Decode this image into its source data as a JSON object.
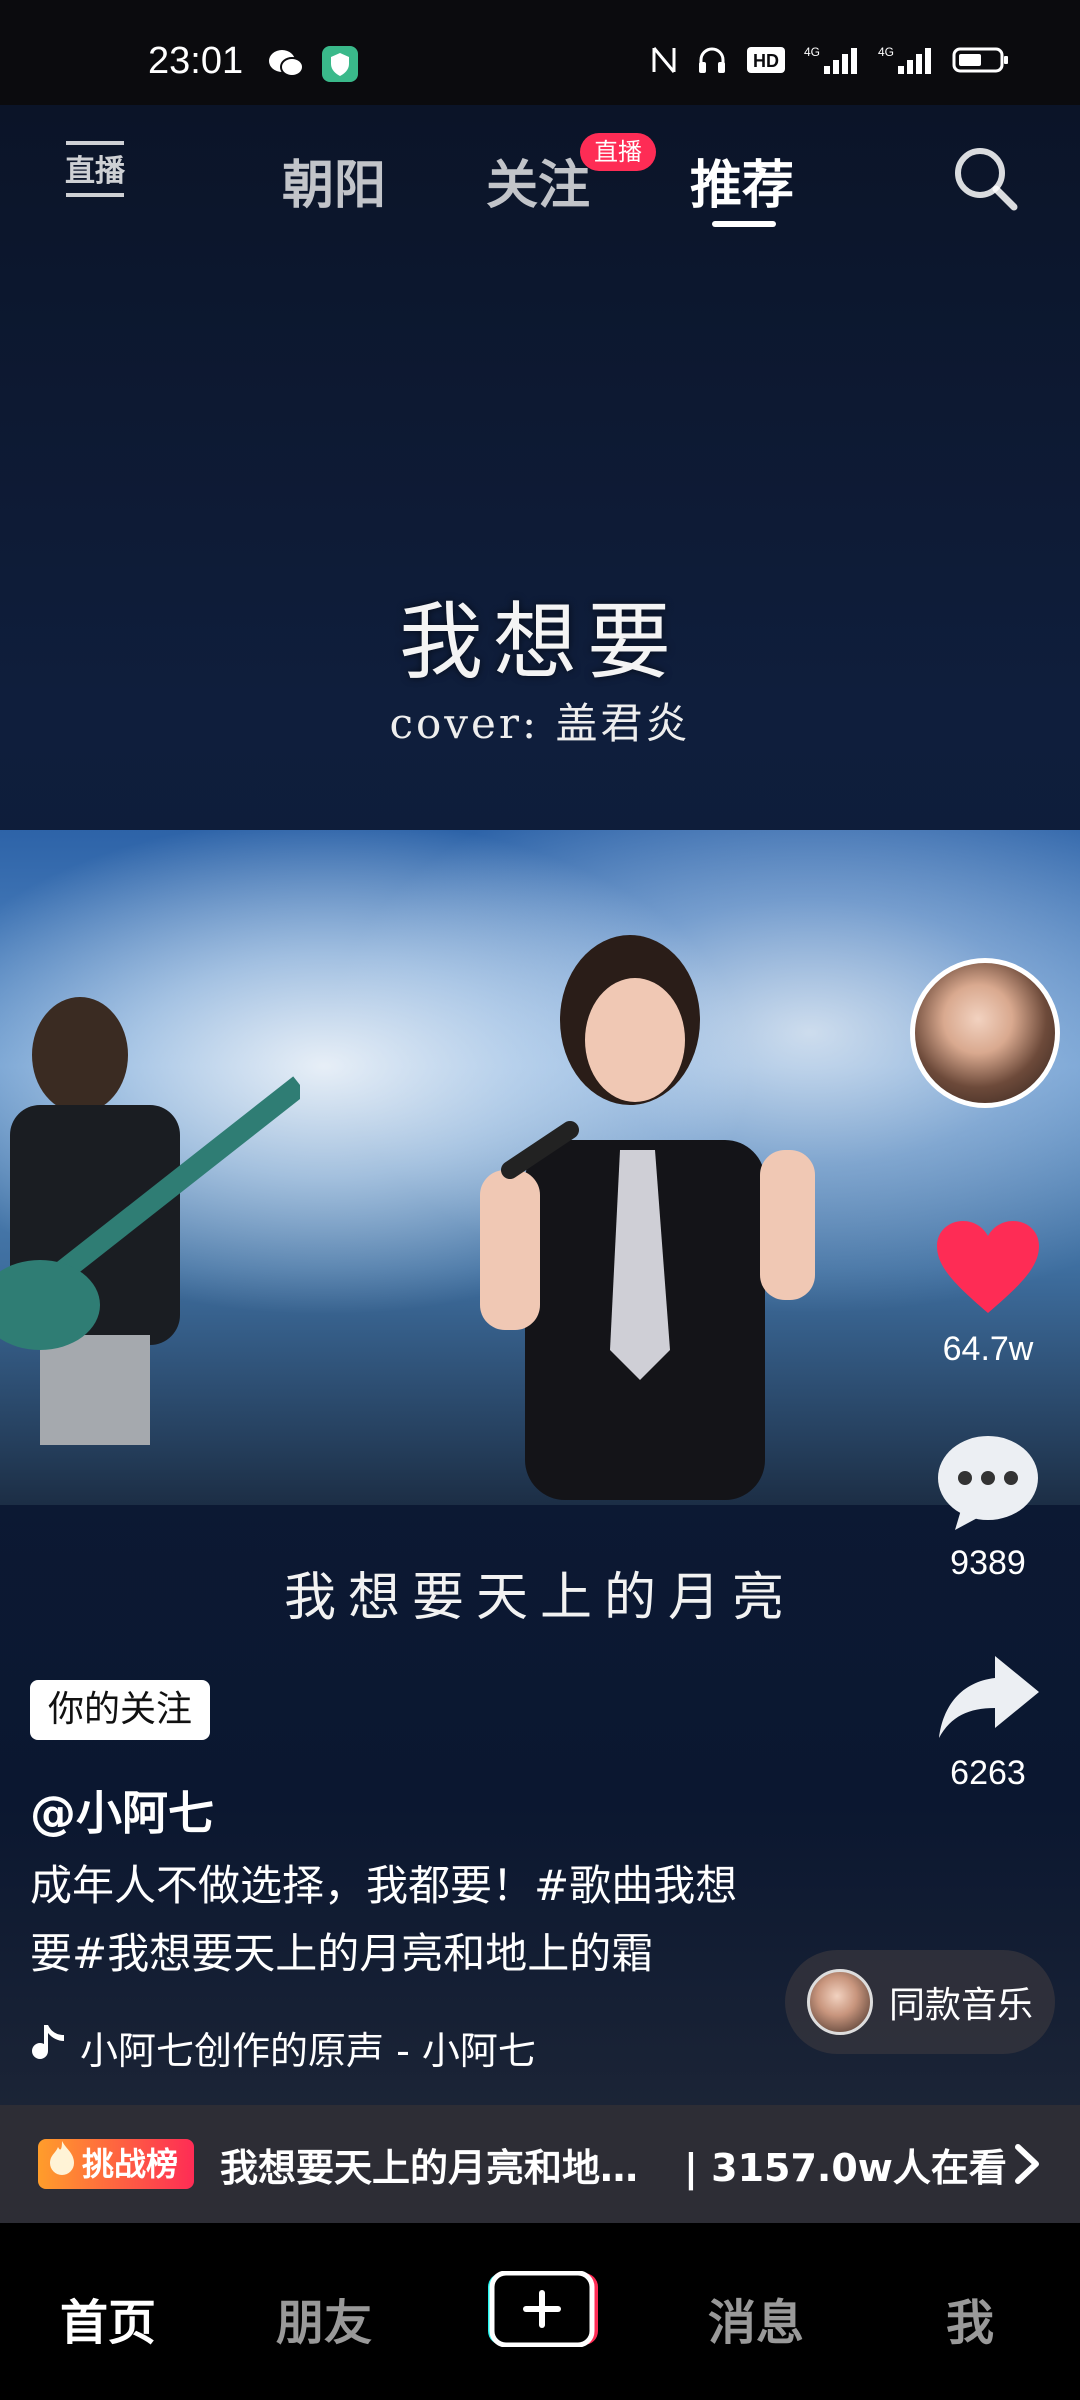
{
  "status_bar": {
    "time": "23:01",
    "hd_label": "HD",
    "net1": "4G",
    "net2": "4G"
  },
  "top_nav": {
    "live_label": "直播",
    "tabs": [
      {
        "label": "朝阳",
        "active": false
      },
      {
        "label": "关注",
        "active": false
      },
      {
        "label": "推荐",
        "active": true
      }
    ],
    "live_badge": "直播"
  },
  "video": {
    "title": "我想要",
    "cover": "cover: 盖君炎",
    "lyric": "我想要天上的月亮"
  },
  "rail": {
    "likes": "64.7w",
    "comments": "9389",
    "shares": "6263"
  },
  "post": {
    "follow_tag": "你的关注",
    "author": "@小阿七",
    "description": "成年人不做选择，我都要！#歌曲我想要#我想要天上的月亮和地上的霜",
    "music": "小阿七创作的原声 - 小阿七",
    "same_music_label": "同款音乐"
  },
  "challenge": {
    "badge": "挑战榜",
    "title": "我想要天上的月亮和地…",
    "viewers": "| 3157.0w人在看"
  },
  "bottom_nav": {
    "items": [
      {
        "label": "首页",
        "active": true
      },
      {
        "label": "朋友",
        "active": false
      },
      {
        "label": "消息",
        "active": false
      },
      {
        "label": "我",
        "active": false
      }
    ]
  },
  "colors": {
    "accent": "#fe2c55",
    "like": "#fe2c55",
    "plus_cyan": "#25f4ee"
  }
}
